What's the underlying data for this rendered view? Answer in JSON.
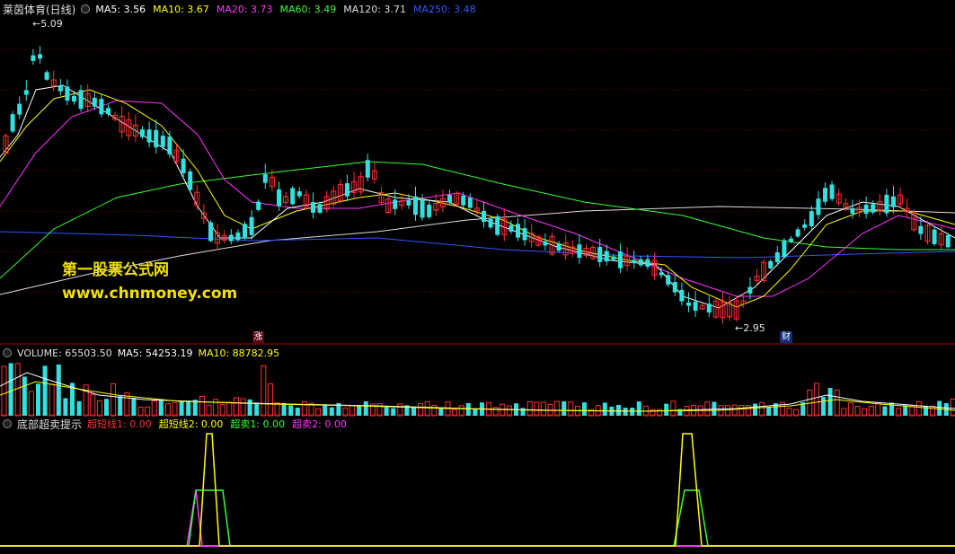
{
  "main": {
    "title": "莱茵体育(日线)",
    "indicators": [
      {
        "label": "MA5: 3.56",
        "color": "#ffffff"
      },
      {
        "label": "MA10: 3.67",
        "color": "#ffff00"
      },
      {
        "label": "MA20: 3.73",
        "color": "#ff33ff"
      },
      {
        "label": "MA60: 3.49",
        "color": "#33ff33"
      },
      {
        "label": "MA120: 3.71",
        "color": "#dddddd"
      },
      {
        "label": "MA250: 3.48",
        "color": "#3355ff"
      }
    ],
    "high_annotation": "5.09",
    "low_annotation": "2.95",
    "marker_zhang": "涨",
    "marker_cai": "财",
    "watermark_title": "第一股票公式网",
    "watermark_url": "www.chnmoney.com"
  },
  "volume": {
    "label": "VOLUME: 65503.50",
    "ma5": "MA5: 54253.19",
    "ma10": "MA10: 88782.95"
  },
  "indicator_panel": {
    "title": "底部超卖提示",
    "items": [
      {
        "label": "超短线1: 0.00",
        "color": "#ff3030"
      },
      {
        "label": "超短线2: 0.00",
        "color": "#ffff00"
      },
      {
        "label": "超卖1: 0.00",
        "color": "#33ff33"
      },
      {
        "label": "超卖2: 0.00",
        "color": "#ff33ff"
      }
    ]
  },
  "colors": {
    "up": "#ff3030",
    "down": "#33e0e0",
    "ma5": "#ffffff",
    "ma10": "#ffff00",
    "ma20": "#ff33ff",
    "ma60": "#33ff33",
    "ma120": "#dddddd",
    "ma250": "#3355ff",
    "grid": "#7a0000"
  }
}
